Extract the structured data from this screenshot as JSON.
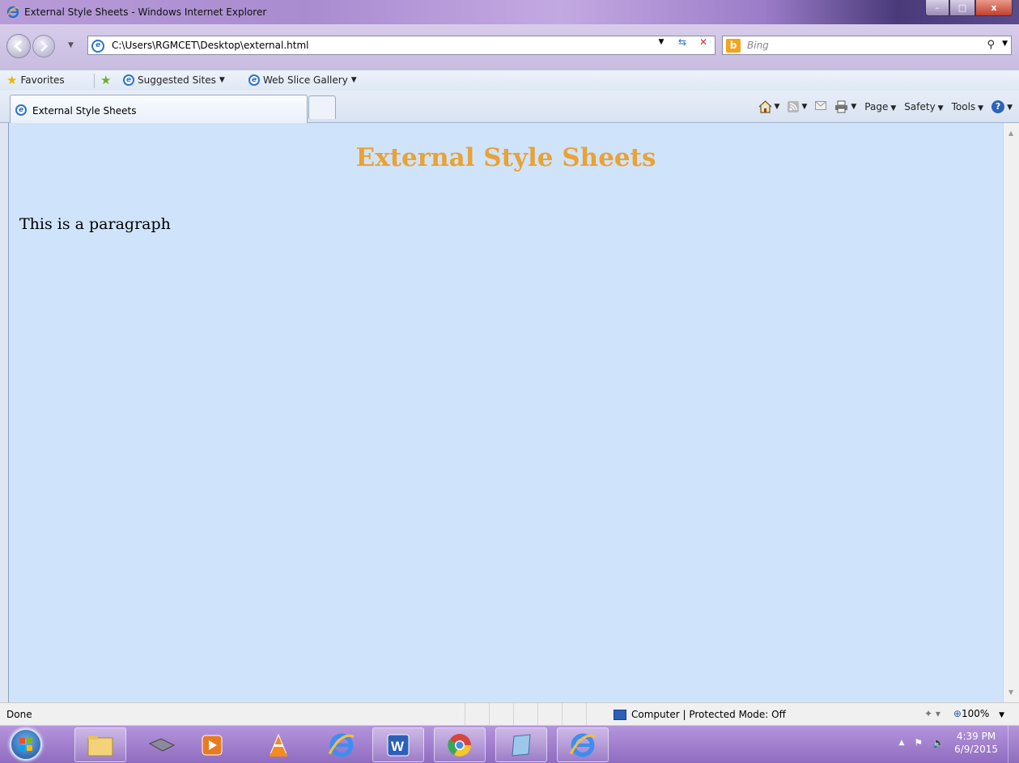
{
  "window": {
    "title": "External Style Sheets - Windows Internet Explorer",
    "min_label": "–",
    "max_label": "□",
    "close_label": "x"
  },
  "address": {
    "url": "C:\\Users\\RGMCET\\Desktop\\external.html",
    "search_placeholder": "Bing"
  },
  "favorites": {
    "label": "Favorites",
    "items": [
      "Suggested Sites",
      "Web Slice Gallery"
    ]
  },
  "tabs": [
    {
      "label": "External Style Sheets"
    }
  ],
  "command_bar": {
    "page": "Page",
    "safety": "Safety",
    "tools": "Tools"
  },
  "page": {
    "heading": "External Style Sheets",
    "paragraph": "This is a paragraph",
    "heading_color": "#e9a235",
    "background": "#cfe4fb"
  },
  "status": {
    "text": "Done",
    "zone": "Computer | Protected Mode: Off",
    "zoom": "100%"
  },
  "taskbar": {
    "time": "4:39 PM",
    "date": "6/9/2015",
    "apps": [
      "explorer-icon",
      "drive-icon",
      "media-player-icon",
      "vlc-icon",
      "internet-explorer-icon",
      "word-icon",
      "chrome-icon",
      "notebook-icon",
      "internet-explorer-icon"
    ]
  }
}
